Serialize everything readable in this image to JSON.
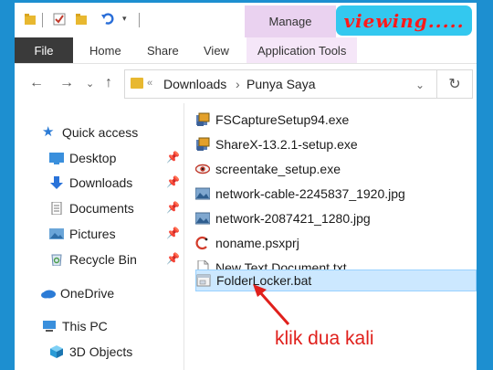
{
  "titlebar": {
    "manage_label": "Manage",
    "viewing_badge": "viewing.....",
    "quick_access_icons": [
      "folder-icon",
      "checkmark-icon",
      "folder-icon",
      "undo-icon",
      "dropdown-icon"
    ]
  },
  "ribbon": {
    "tabs": [
      {
        "label": "File"
      },
      {
        "label": "Home"
      },
      {
        "label": "Share"
      },
      {
        "label": "View"
      },
      {
        "label": "Application Tools"
      }
    ]
  },
  "address": {
    "path": [
      "Downloads",
      "Punya Saya"
    ]
  },
  "nav": {
    "quick_access": "Quick access",
    "items": [
      {
        "label": "Desktop",
        "icon": "desktop-icon",
        "pinned": true
      },
      {
        "label": "Downloads",
        "icon": "download-icon",
        "pinned": true
      },
      {
        "label": "Documents",
        "icon": "document-icon",
        "pinned": true
      },
      {
        "label": "Pictures",
        "icon": "pictures-icon",
        "pinned": true
      },
      {
        "label": "Recycle Bin",
        "icon": "recycle-bin-icon",
        "pinned": true
      }
    ],
    "onedrive": "OneDrive",
    "this_pc": "This PC",
    "objects_3d": "3D Objects"
  },
  "files": [
    {
      "name": "FSCaptureSetup94.exe",
      "icon": "installer-icon"
    },
    {
      "name": "ShareX-13.2.1-setup.exe",
      "icon": "installer-icon"
    },
    {
      "name": "screentake_setup.exe",
      "icon": "eye-icon"
    },
    {
      "name": "network-cable-2245837_1920.jpg",
      "icon": "image-icon"
    },
    {
      "name": "network-2087421_1280.jpg",
      "icon": "image-icon"
    },
    {
      "name": "noname.psxprj",
      "icon": "project-icon"
    },
    {
      "name": "New Text Document.txt",
      "icon": "text-file-icon"
    },
    {
      "name": "FolderLocker.bat",
      "icon": "batch-file-icon",
      "selected": true
    }
  ],
  "annotation": "klik dua kali",
  "colors": {
    "background": "#1d8fd0",
    "badge": "#33c8ef",
    "annotation": "#e0201c",
    "selection": "#cce8ff"
  }
}
